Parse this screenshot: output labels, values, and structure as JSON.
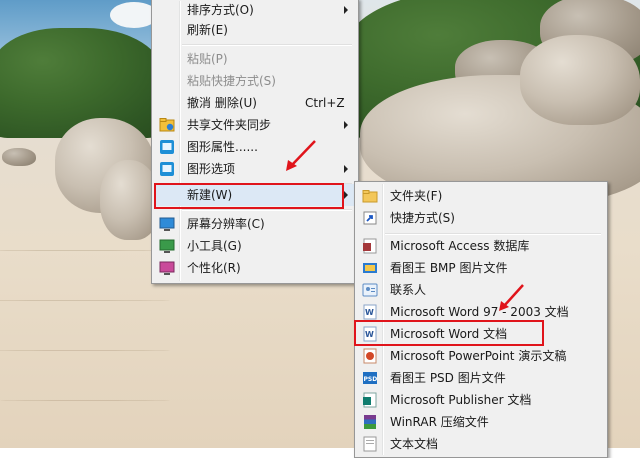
{
  "context_menu": {
    "items": [
      {
        "label": "排序方式(O)",
        "has_submenu": true
      },
      {
        "label": "刷新(E)"
      },
      {
        "label": "粘贴(P)",
        "disabled": true
      },
      {
        "label": "粘贴快捷方式(S)",
        "disabled": true
      },
      {
        "label": "撤消 删除(U)",
        "shortcut": "Ctrl+Z"
      },
      {
        "label": "共享文件夹同步",
        "has_submenu": true,
        "icon": "shared-folder-sync-icon"
      },
      {
        "label": "图形属性......",
        "icon": "graphics-properties-icon"
      },
      {
        "label": "图形选项",
        "has_submenu": true,
        "icon": "graphics-options-icon"
      },
      {
        "label": "新建(W)",
        "has_submenu": true,
        "highlighted": true
      },
      {
        "label": "屏幕分辨率(C)",
        "icon": "screen-resolution-icon"
      },
      {
        "label": "小工具(G)",
        "icon": "gadgets-icon"
      },
      {
        "label": "个性化(R)",
        "icon": "personalize-icon"
      }
    ]
  },
  "new_submenu": {
    "items": [
      {
        "label": "文件夹(F)",
        "icon": "folder-icon"
      },
      {
        "label": "快捷方式(S)",
        "icon": "shortcut-icon"
      },
      {
        "label": "Microsoft Access 数据库",
        "icon": "access-icon"
      },
      {
        "label": "看图王 BMP 图片文件",
        "icon": "bmp-image-icon"
      },
      {
        "label": "联系人",
        "icon": "contact-icon"
      },
      {
        "label": "Microsoft Word 97 - 2003 文档",
        "icon": "word-97-2003-icon"
      },
      {
        "label": "Microsoft Word 文档",
        "icon": "word-document-icon",
        "highlighted": true
      },
      {
        "label": "Microsoft PowerPoint 演示文稿",
        "icon": "powerpoint-icon"
      },
      {
        "label": "看图王 PSD 图片文件",
        "icon": "psd-image-icon"
      },
      {
        "label": "Microsoft Publisher 文档",
        "icon": "publisher-icon"
      },
      {
        "label": "WinRAR 压缩文件",
        "icon": "winrar-icon"
      },
      {
        "label": "文本文档",
        "icon": "text-document-icon"
      }
    ]
  },
  "colors": {
    "menu_background": "#f0f0f0",
    "annotation_red": "#e0141b",
    "disabled_text": "#8d8d8d"
  }
}
